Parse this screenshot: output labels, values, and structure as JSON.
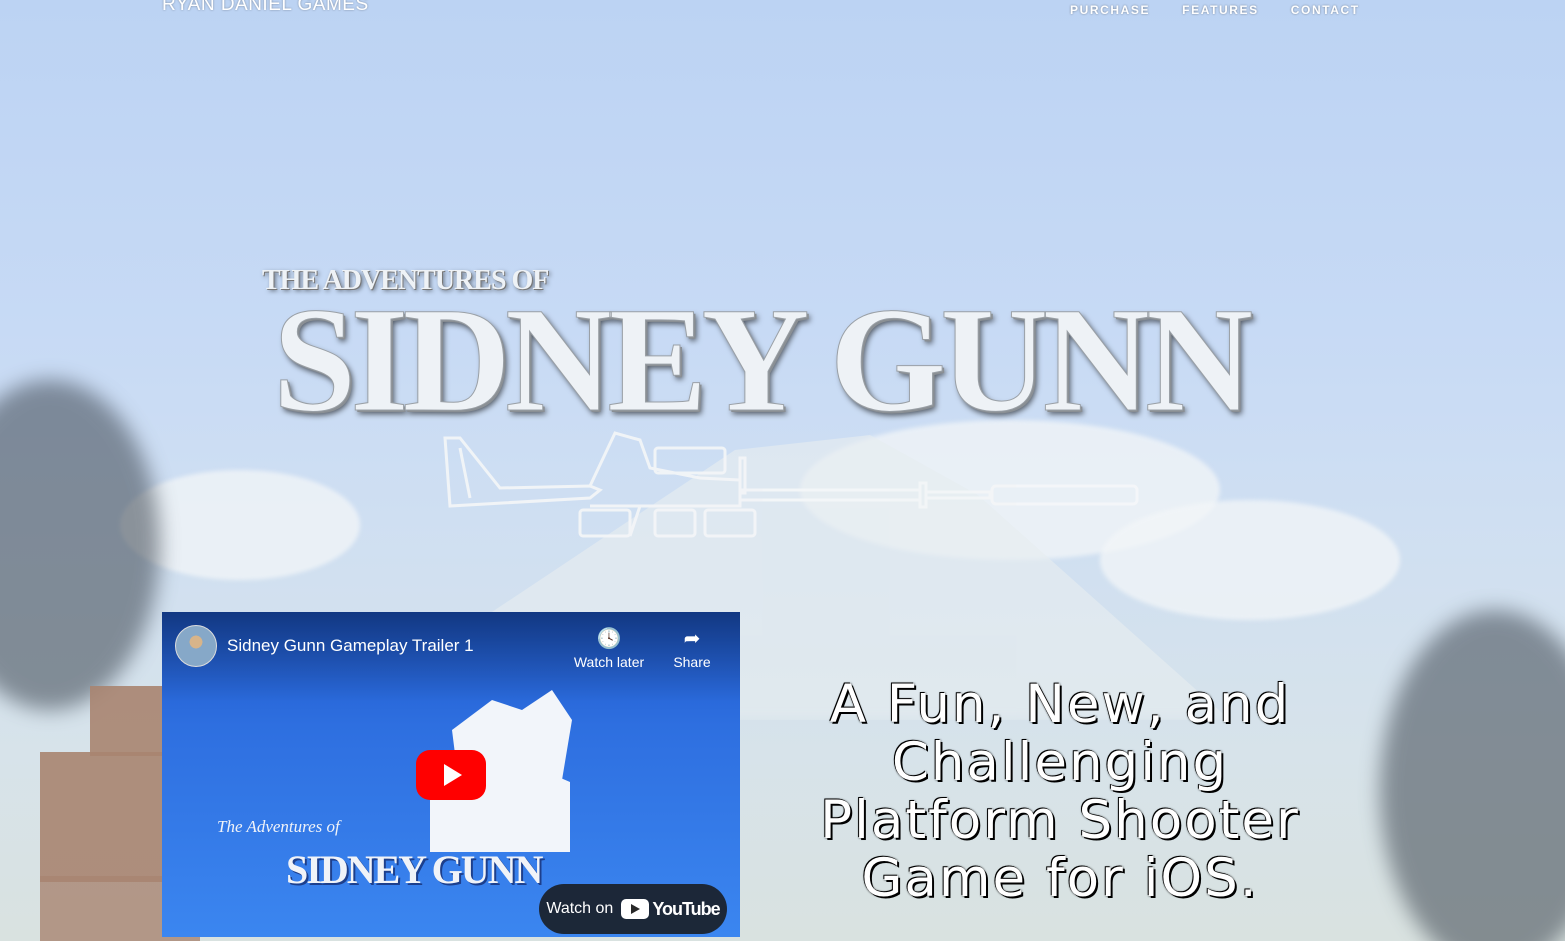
{
  "header": {
    "brand": "RYAN DANIEL GAMES",
    "nav": [
      "PURCHASE",
      "FEATURES",
      "CONTACT"
    ]
  },
  "hero": {
    "logo_subtitle": "THE ADVENTURES OF",
    "logo_title": "SIDNEY GUNN",
    "tagline": "A Fun, New, and Challenging Platform Shooter Game for iOS."
  },
  "video": {
    "title": "Sidney Gunn Gameplay Trailer 1",
    "watch_later": "Watch later",
    "share": "Share",
    "thumbnail_script": "The Adventures of",
    "thumbnail_title": "SIDNEY GUNN",
    "watch_on": "Watch on",
    "youtube": "YouTube"
  },
  "colors": {
    "sky": "#c7daf5",
    "youtube_red": "#ff0000",
    "thumbnail_blue": "#2e6fe0"
  }
}
